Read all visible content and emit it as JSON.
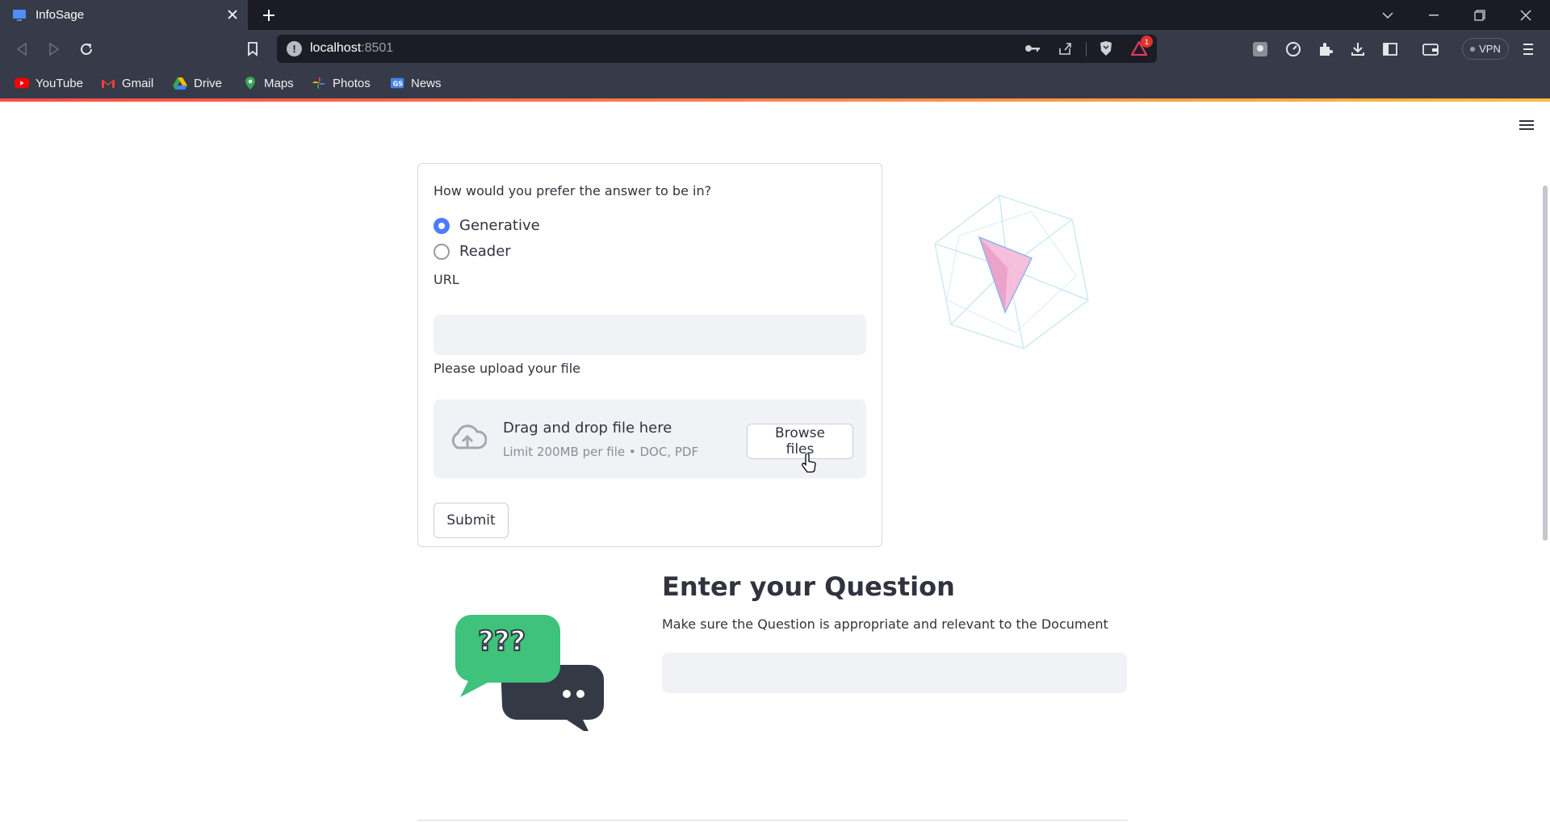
{
  "browser": {
    "tab_title": "InfoSage",
    "url_host": "localhost",
    "url_port": ":8501",
    "vpn_label": "VPN",
    "notification_count": "1",
    "bookmarks": [
      {
        "label": "YouTube",
        "icon": "youtube-icon",
        "color": "#ff0000"
      },
      {
        "label": "Gmail",
        "icon": "gmail-icon",
        "color": "#ea4335"
      },
      {
        "label": "Drive",
        "icon": "drive-icon",
        "color": "#34a853"
      },
      {
        "label": "Maps",
        "icon": "maps-icon",
        "color": "#4285f4"
      },
      {
        "label": "Photos",
        "icon": "photos-icon",
        "color": "#fbbc04"
      },
      {
        "label": "News",
        "icon": "news-icon",
        "color": "#4285f4"
      }
    ]
  },
  "form": {
    "answer_question": "How would you prefer the answer to be in?",
    "options": [
      {
        "label": "Generative",
        "selected": true
      },
      {
        "label": "Reader",
        "selected": false
      }
    ],
    "url_label": "URL",
    "url_value": "",
    "upload_label": "Please upload your file",
    "dropzone_title": "Drag and drop file here",
    "dropzone_limit": "Limit 200MB per file • DOC, PDF",
    "browse_label": "Browse files",
    "submit_label": "Submit"
  },
  "question": {
    "title": "Enter your Question",
    "subtitle": "Make sure the Question is appropriate and relevant to the Document",
    "value": ""
  },
  "colors": {
    "accent": "#4a7dff",
    "chrome_dark": "#1a1b25",
    "chrome": "#373a48",
    "speech_green": "#3ec27c",
    "speech_dark": "#343a45"
  }
}
